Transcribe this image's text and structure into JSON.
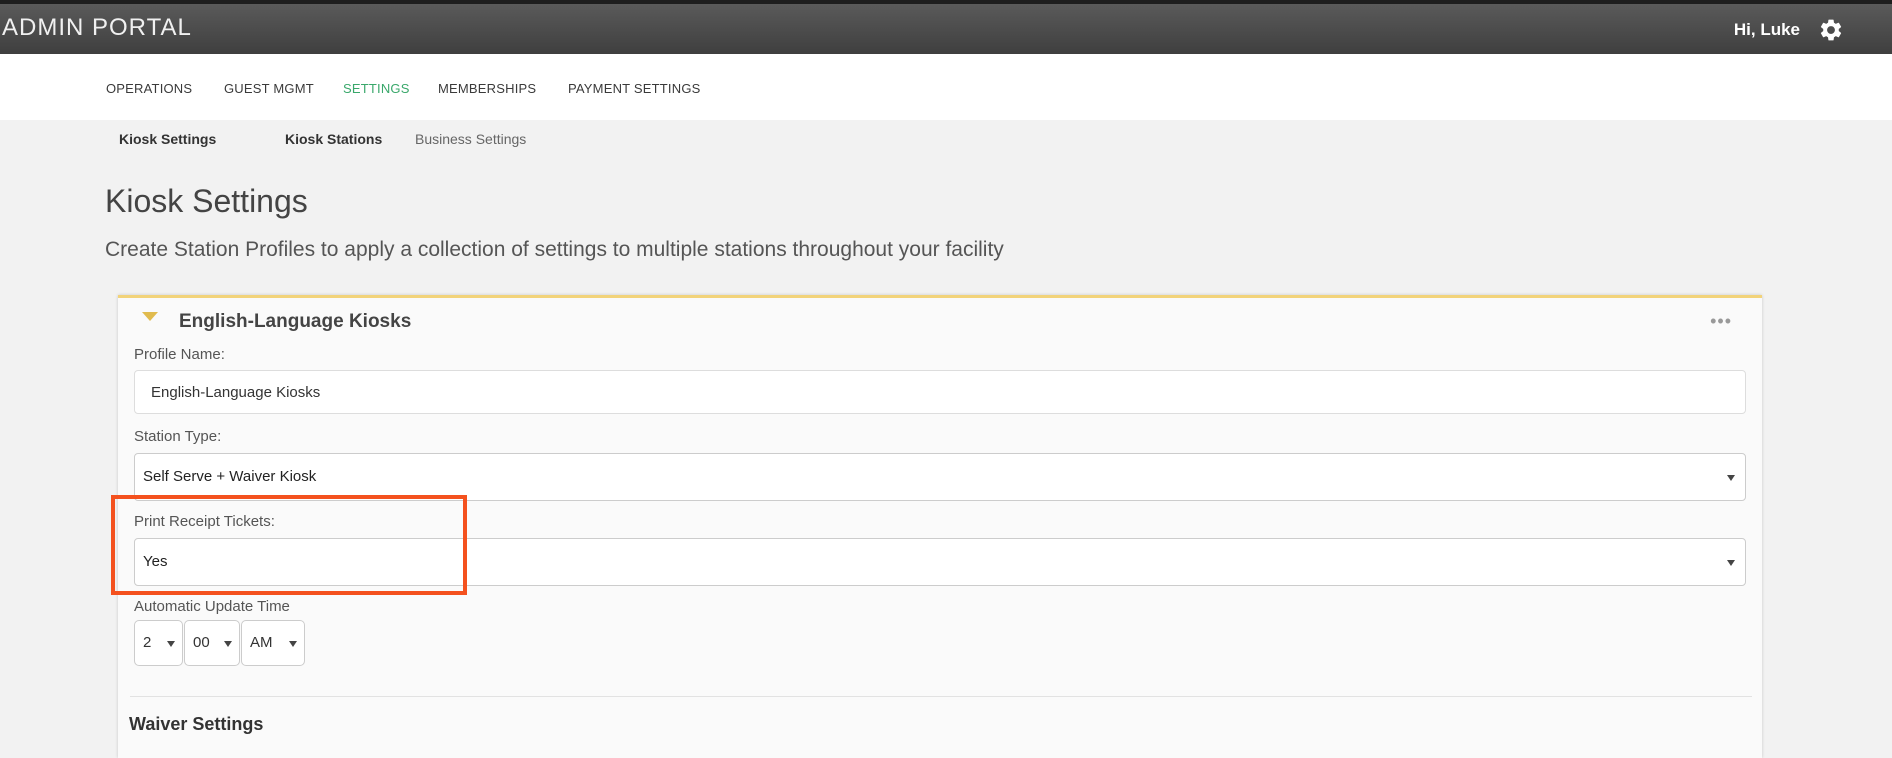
{
  "header": {
    "brand": "ADMIN PORTAL",
    "greeting": "Hi, Luke",
    "settings_icon": "gear-icon"
  },
  "main_nav": [
    {
      "label": "OPERATIONS",
      "active": false
    },
    {
      "label": "GUEST MGMT",
      "active": false
    },
    {
      "label": "SETTINGS",
      "active": true
    },
    {
      "label": "MEMBERSHIPS",
      "active": false
    },
    {
      "label": "PAYMENT SETTINGS",
      "active": false
    }
  ],
  "sub_nav": [
    {
      "label": "Kiosk Settings"
    },
    {
      "label": "Kiosk Stations"
    },
    {
      "label": "Business Settings"
    }
  ],
  "page": {
    "title": "Kiosk Settings",
    "subtitle": "Create Station Profiles to apply a collection of settings to multiple stations throughout your facility"
  },
  "profile_card": {
    "title": "English-Language Kiosks",
    "more_icon": "more-dots-icon",
    "profile_name_label": "Profile Name:",
    "profile_name_value": "English-Language Kiosks",
    "station_type_label": "Station Type:",
    "station_type_value": "Self Serve + Waiver Kiosk",
    "print_receipt_label": "Print Receipt Tickets:",
    "print_receipt_value": "Yes",
    "update_time_label": "Automatic Update Time",
    "update_hour": "2",
    "update_minute": "00",
    "update_period": "AM",
    "waiver_section_title": "Waiver Settings"
  },
  "colors": {
    "active_nav": "#3aa86b",
    "card_accent": "#f2d37a",
    "highlight": "#f4511e"
  }
}
